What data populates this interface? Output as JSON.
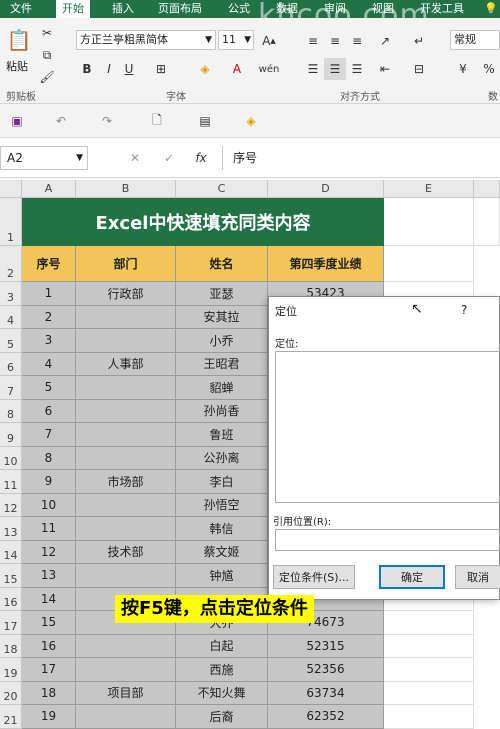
{
  "menu": [
    "文件",
    "开始",
    "插入",
    "页面布局",
    "公式",
    "数据",
    "审阅",
    "视图",
    "开发工具"
  ],
  "menu_active": "开始",
  "watermark": "khcoo.com",
  "ribbon": {
    "paste": "粘贴",
    "clipboard_group": "剪贴板",
    "font_name": "方正兰亭粗黑简体",
    "font_size": "11",
    "font_group": "字体",
    "align_group": "对齐方式",
    "number_format": "常规",
    "number_group_partial": "数"
  },
  "name_box": "A2",
  "formula_content": "序号",
  "columns": [
    "A",
    "B",
    "C",
    "D",
    "E"
  ],
  "sheet_title": "Excel中快速填充同类内容",
  "headers": [
    "序号",
    "部门",
    "姓名",
    "第四季度业绩"
  ],
  "rows": [
    {
      "no": "1",
      "dept": "行政部",
      "name": "亚瑟",
      "score": "53423"
    },
    {
      "no": "2",
      "dept": "",
      "name": "安其拉",
      "score": ""
    },
    {
      "no": "3",
      "dept": "",
      "name": "小乔",
      "score": ""
    },
    {
      "no": "4",
      "dept": "人事部",
      "name": "王昭君",
      "score": ""
    },
    {
      "no": "5",
      "dept": "",
      "name": "貂蝉",
      "score": ""
    },
    {
      "no": "6",
      "dept": "",
      "name": "孙尚香",
      "score": ""
    },
    {
      "no": "7",
      "dept": "",
      "name": "鲁班",
      "score": ""
    },
    {
      "no": "8",
      "dept": "",
      "name": "公孙离",
      "score": ""
    },
    {
      "no": "9",
      "dept": "市场部",
      "name": "李白",
      "score": ""
    },
    {
      "no": "10",
      "dept": "",
      "name": "孙悟空",
      "score": ""
    },
    {
      "no": "11",
      "dept": "",
      "name": "韩信",
      "score": ""
    },
    {
      "no": "12",
      "dept": "技术部",
      "name": "蔡文姬",
      "score": ""
    },
    {
      "no": "13",
      "dept": "",
      "name": "钟馗",
      "score": ""
    },
    {
      "no": "14",
      "dept": "",
      "name": "",
      "score": ""
    },
    {
      "no": "15",
      "dept": "",
      "name": "大乔",
      "score": "74673"
    },
    {
      "no": "16",
      "dept": "",
      "name": "白起",
      "score": "52315"
    },
    {
      "no": "17",
      "dept": "",
      "name": "西施",
      "score": "52356"
    },
    {
      "no": "18",
      "dept": "项目部",
      "name": "不知火舞",
      "score": "63734"
    },
    {
      "no": "19",
      "dept": "",
      "name": "后裔",
      "score": "62352"
    }
  ],
  "row_numbers": [
    "1",
    "2",
    "3",
    "4",
    "5",
    "6",
    "7",
    "8",
    "9",
    "10",
    "11",
    "12",
    "13",
    "14",
    "15",
    "16",
    "17",
    "18",
    "19",
    "20",
    "21"
  ],
  "dialog": {
    "title": "定位",
    "help": "?",
    "goto_label": "定位:",
    "ref_label": "引用位置(R):",
    "special_button": "定位条件(S)...",
    "ok_button": "确定",
    "cancel_button": "取消"
  },
  "caption": "按F5键，点击定位条件",
  "colors": {
    "excel_green": "#217346",
    "header_gold": "#f2c558",
    "selection_gray": "#c6c6c6",
    "caption_yellow": "#ffff00"
  }
}
